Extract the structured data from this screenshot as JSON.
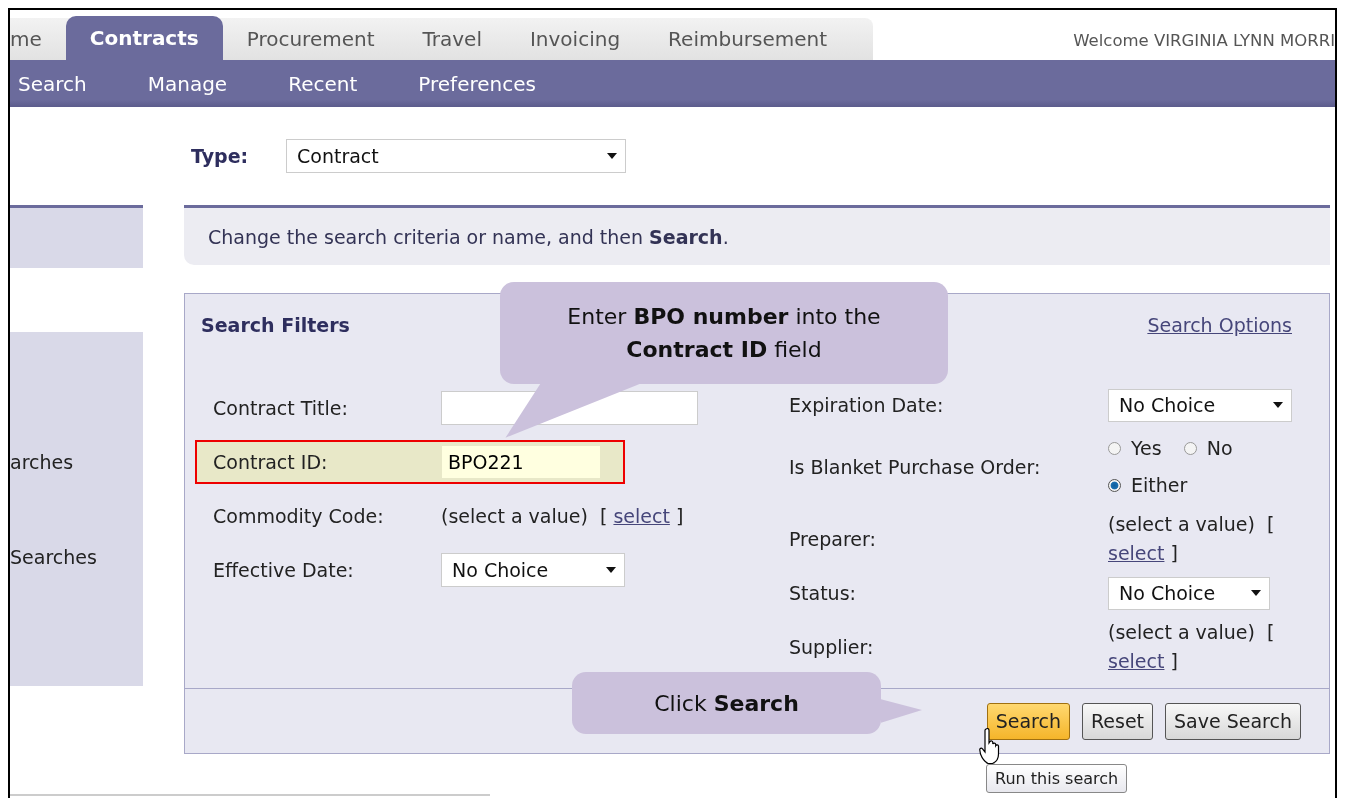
{
  "tabs": [
    {
      "label": "me",
      "selected": false
    },
    {
      "label": "Contracts",
      "selected": true
    },
    {
      "label": "Procurement",
      "selected": false
    },
    {
      "label": "Travel",
      "selected": false
    },
    {
      "label": "Invoicing",
      "selected": false
    },
    {
      "label": "Reimbursement",
      "selected": false
    }
  ],
  "welcome": "Welcome VIRGINIA LYNN MORRI",
  "subnav": [
    "Search",
    "Manage",
    "Recent",
    "Preferences"
  ],
  "type": {
    "label": "Type:",
    "value": "Contract"
  },
  "sidebar": {
    "items": [
      "arches",
      "Searches"
    ]
  },
  "info": "Change the search criteria or name, and then **Search**.",
  "filters": {
    "title": "Search Filters",
    "options_link": "Search Options",
    "left": [
      {
        "kind": "text",
        "label": "Contract Title:",
        "highlighted": false
      },
      {
        "kind": "text",
        "label": "Contract ID:",
        "value": "BPO221",
        "highlighted": true
      },
      {
        "kind": "lookup",
        "label": "Commodity Code:",
        "value": "(select a value)",
        "open": "[",
        "link": "select",
        "close": "]"
      },
      {
        "kind": "select",
        "label": "Effective Date:",
        "value": "No Choice"
      }
    ],
    "right": [
      {
        "kind": "select",
        "label": "Expiration Date:",
        "value": "No Choice"
      },
      {
        "kind": "radio",
        "label": "Is Blanket Purchase Order:",
        "options": [
          {
            "label": "Yes",
            "selected": false
          },
          {
            "label": "No",
            "selected": false
          },
          {
            "label": "Either",
            "selected": true
          }
        ]
      },
      {
        "kind": "lookup",
        "label": "Preparer:",
        "value": "(select a value)",
        "open": "[",
        "link": "select",
        "close": "]"
      },
      {
        "kind": "select",
        "label": "Status:",
        "value": "No Choice"
      },
      {
        "kind": "lookup",
        "label": "Supplier:",
        "value": "(select a value)",
        "open": "[",
        "link": "select",
        "close": "]"
      }
    ]
  },
  "buttons": [
    {
      "label": "Search",
      "primary": true
    },
    {
      "label": "Reset",
      "primary": false
    },
    {
      "label": "Save Search",
      "primary": false
    }
  ],
  "tooltip": "Run this search",
  "callouts": [
    {
      "text": "Enter **BPO number** into the **Contract ID** field"
    },
    {
      "text": "Click **Search**"
    }
  ]
}
